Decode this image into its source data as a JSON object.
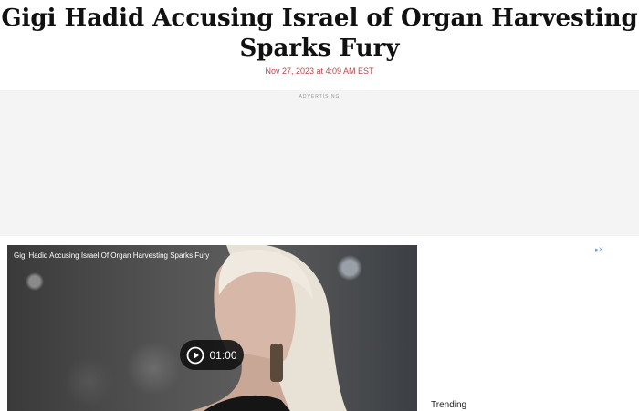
{
  "article": {
    "headline": "Gigi Hadid Accusing Israel of Organ Harvesting Sparks Fury",
    "date": "Nov 27, 2023 at 4:09 AM EST"
  },
  "ad": {
    "label": "ADVERTISING"
  },
  "video": {
    "title": "Gigi Hadid Accusing Israel Of Organ Harvesting Sparks Fury",
    "duration": "01:00",
    "play_icon": "play-circle-icon"
  },
  "sidebar": {
    "trending_label": "Trending",
    "ad_choices_icon": "ad-choices-icon"
  },
  "colors": {
    "date": "#b5474b",
    "ad_background": "#f4f4f4",
    "play_pill": "#121212"
  }
}
